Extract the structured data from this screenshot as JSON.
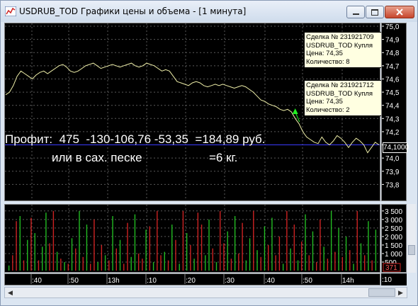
{
  "window": {
    "title": "USDRUB_TOD Графики цены и объема - [1 минута]",
    "app_icon": "chart-app-icon",
    "buttons": [
      "minimize-icon",
      "maximize-icon",
      "close-icon"
    ]
  },
  "colors": {
    "price_line": "#eeeea8",
    "level_line": "#3b3bff",
    "grid": "#5a5a5a",
    "volume_buy": "#22bb22",
    "volume_sell": "#cc2222",
    "trade_marker": "#22ee22",
    "tooltip_bg": "#ffffe1"
  },
  "price_axis": {
    "ticks": [
      "75,0",
      "74,9",
      "74,8",
      "74,7",
      "74,6",
      "74,5",
      "74,4",
      "74,3",
      "74,2",
      "74,1",
      "74,0",
      "73,9",
      "73,8"
    ],
    "current_price_label": "74,1000"
  },
  "volume_axis": {
    "ticks": [
      "3 500",
      "3 000",
      "2 500",
      "2 000",
      "1 500",
      "1 000",
      "500"
    ],
    "badge": "371"
  },
  "time_axis": {
    "ticks": [
      ":40",
      ":50",
      "13h",
      ":10",
      ":20",
      ":30",
      ":40",
      ":50",
      "14h",
      ":10"
    ]
  },
  "tooltips": [
    {
      "deal": "Сделка № 231921709",
      "instrument": "USDRUB_TOD Купля",
      "price": "Цена: 74,35",
      "qty": "Количество: 8"
    },
    {
      "deal": "Сделка № 231921712",
      "instrument": "USDRUB_TOD Купля",
      "price": "Цена: 74,35",
      "qty": "Количество: 2"
    }
  ],
  "overlay": {
    "line1": "Профит:  475  -130-106,76 -53,35  =184,89 руб.",
    "line2": "или в сах. песке                    =6 кг."
  },
  "chart_data": {
    "type": "line",
    "price": {
      "ylim": [
        73.7,
        75.0
      ],
      "level": 74.1,
      "trade_price": 74.35,
      "values": [
        74.48,
        74.5,
        74.55,
        74.62,
        74.66,
        74.64,
        74.62,
        74.6,
        74.63,
        74.65,
        74.66,
        74.64,
        74.66,
        74.68,
        74.7,
        74.71,
        74.69,
        74.66,
        74.65,
        74.66,
        74.68,
        74.7,
        74.71,
        74.72,
        74.7,
        74.68,
        74.69,
        74.7,
        74.71,
        74.7,
        74.69,
        74.7,
        74.71,
        74.72,
        74.7,
        74.69,
        74.7,
        74.72,
        74.71,
        74.7,
        74.68,
        74.66,
        74.67,
        74.66,
        74.62,
        74.58,
        74.57,
        74.56,
        74.55,
        74.57,
        74.58,
        74.57,
        74.55,
        74.54,
        74.55,
        74.56,
        74.55,
        74.56,
        74.55,
        74.54,
        74.53,
        74.54,
        74.55,
        74.54,
        74.52,
        74.5,
        74.47,
        74.44,
        74.43,
        74.41,
        74.4,
        74.39,
        74.37,
        74.36,
        74.37,
        74.35,
        74.3,
        74.26,
        74.2,
        74.16,
        74.14,
        74.12,
        74.11,
        74.16,
        74.12,
        74.1,
        74.13,
        74.17,
        74.15,
        74.12,
        74.08,
        74.12,
        74.15,
        74.13,
        74.1,
        74.04,
        74.08,
        74.12,
        74.1
      ]
    },
    "volume": {
      "ylim": [
        0,
        3700
      ],
      "bars": [
        [
          300,
          "buy"
        ],
        [
          900,
          "sell"
        ],
        [
          2900,
          "sell"
        ],
        [
          3200,
          "buy"
        ],
        [
          600,
          "sell"
        ],
        [
          1800,
          "buy"
        ],
        [
          3100,
          "sell"
        ],
        [
          2200,
          "buy"
        ],
        [
          600,
          "sell"
        ],
        [
          1400,
          "buy"
        ],
        [
          3400,
          "buy"
        ],
        [
          1600,
          "sell"
        ],
        [
          3500,
          "sell"
        ],
        [
          1100,
          "buy"
        ],
        [
          700,
          "sell"
        ],
        [
          500,
          "buy"
        ],
        [
          400,
          "sell"
        ],
        [
          1900,
          "buy"
        ],
        [
          1300,
          "sell"
        ],
        [
          3500,
          "buy"
        ],
        [
          800,
          "sell"
        ],
        [
          2700,
          "buy"
        ],
        [
          400,
          "sell"
        ],
        [
          3000,
          "sell"
        ],
        [
          500,
          "buy"
        ],
        [
          1500,
          "sell"
        ],
        [
          900,
          "buy"
        ],
        [
          600,
          "sell"
        ],
        [
          3200,
          "buy"
        ],
        [
          1300,
          "sell"
        ],
        [
          1800,
          "buy"
        ],
        [
          400,
          "sell"
        ],
        [
          2800,
          "sell"
        ],
        [
          800,
          "buy"
        ],
        [
          3300,
          "buy"
        ],
        [
          1000,
          "sell"
        ],
        [
          700,
          "sell"
        ],
        [
          2400,
          "buy"
        ],
        [
          2600,
          "sell"
        ],
        [
          500,
          "buy"
        ],
        [
          3500,
          "sell"
        ],
        [
          900,
          "sell"
        ],
        [
          1100,
          "buy"
        ],
        [
          600,
          "sell"
        ],
        [
          2700,
          "buy"
        ],
        [
          1800,
          "sell"
        ],
        [
          400,
          "buy"
        ],
        [
          3500,
          "sell"
        ],
        [
          2200,
          "buy"
        ],
        [
          1500,
          "sell"
        ],
        [
          700,
          "buy"
        ],
        [
          3400,
          "sell"
        ],
        [
          2700,
          "sell"
        ],
        [
          900,
          "buy"
        ],
        [
          3000,
          "buy"
        ],
        [
          1300,
          "sell"
        ],
        [
          500,
          "buy"
        ],
        [
          3500,
          "sell"
        ],
        [
          1600,
          "sell"
        ],
        [
          2300,
          "buy"
        ],
        [
          700,
          "sell"
        ],
        [
          3200,
          "buy"
        ],
        [
          1000,
          "sell"
        ],
        [
          2800,
          "sell"
        ],
        [
          600,
          "buy"
        ],
        [
          1900,
          "buy"
        ],
        [
          3500,
          "sell"
        ],
        [
          1200,
          "buy"
        ],
        [
          800,
          "sell"
        ],
        [
          2600,
          "buy"
        ],
        [
          1500,
          "sell"
        ],
        [
          3100,
          "buy"
        ],
        [
          900,
          "sell"
        ],
        [
          2000,
          "sell"
        ],
        [
          400,
          "buy"
        ],
        [
          3500,
          "sell"
        ],
        [
          1300,
          "buy"
        ],
        [
          2700,
          "sell"
        ],
        [
          600,
          "buy"
        ],
        [
          1700,
          "sell"
        ],
        [
          3300,
          "buy"
        ],
        [
          900,
          "sell"
        ],
        [
          2300,
          "buy"
        ],
        [
          500,
          "sell"
        ],
        [
          3000,
          "sell"
        ],
        [
          1400,
          "buy"
        ],
        [
          700,
          "sell"
        ],
        [
          3500,
          "buy"
        ],
        [
          1100,
          "sell"
        ],
        [
          2500,
          "buy"
        ],
        [
          800,
          "sell"
        ],
        [
          2000,
          "buy"
        ],
        [
          1200,
          "sell"
        ],
        [
          400,
          "buy"
        ],
        [
          3500,
          "sell"
        ],
        [
          1600,
          "buy"
        ],
        [
          900,
          "sell"
        ],
        [
          2900,
          "buy"
        ],
        [
          600,
          "sell"
        ],
        [
          2400,
          "buy"
        ]
      ]
    }
  }
}
